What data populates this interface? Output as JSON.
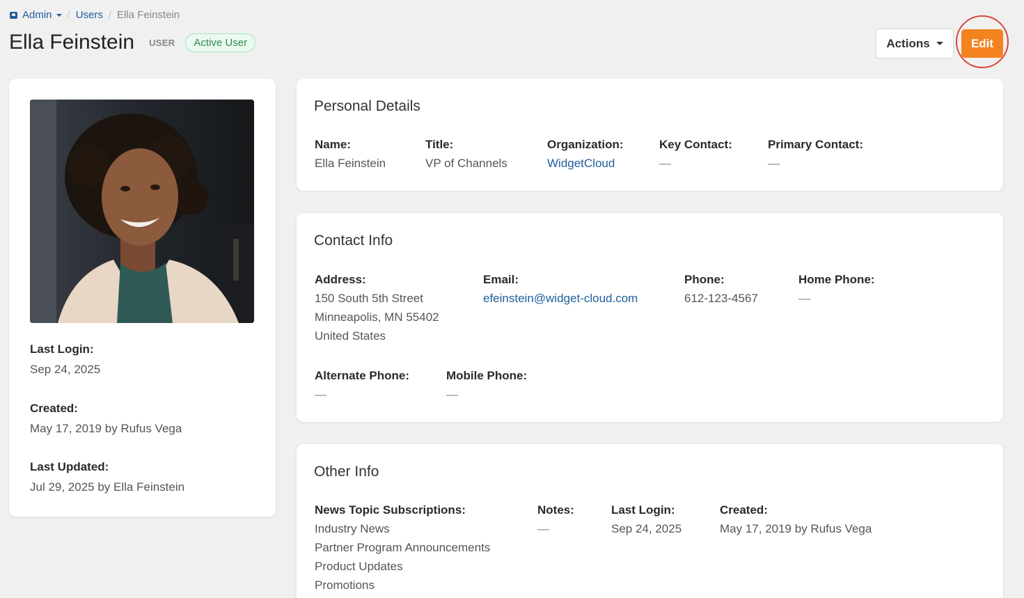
{
  "breadcrumb": {
    "admin": "Admin",
    "separator": "/",
    "users": "Users",
    "current": "Ella Feinstein"
  },
  "header": {
    "title": "Ella Feinstein",
    "role": "USER",
    "status": "Active User",
    "actions_label": "Actions",
    "edit_label": "Edit"
  },
  "profile": {
    "last_login_label": "Last Login:",
    "last_login": "Sep 24, 2025",
    "created_label": "Created:",
    "created": "May 17, 2019 by Rufus Vega",
    "last_updated_label": "Last Updated:",
    "last_updated": "Jul 29, 2025 by Ella Feinstein"
  },
  "personal": {
    "title": "Personal Details",
    "name_label": "Name:",
    "name": "Ella Feinstein",
    "title_label": "Title:",
    "job_title": "VP of Channels",
    "org_label": "Organization:",
    "org": "WidgetCloud",
    "key_label": "Key Contact:",
    "key": "—",
    "primary_label": "Primary Contact:",
    "primary": "—"
  },
  "contact": {
    "title": "Contact Info",
    "address_label": "Address:",
    "address_line1": "150 South 5th Street",
    "address_line2": "Minneapolis, MN 55402",
    "address_line3": "United States",
    "email_label": "Email:",
    "email": "efeinstein@widget-cloud.com",
    "phone_label": "Phone:",
    "phone": "612-123-4567",
    "home_label": "Home Phone:",
    "home": "—",
    "alt_label": "Alternate Phone:",
    "alt": "—",
    "mobile_label": "Mobile Phone:",
    "mobile": "—"
  },
  "other": {
    "title": "Other Info",
    "subs_label": "News Topic Subscriptions:",
    "subs": [
      "Industry News",
      "Partner Program Announcements",
      "Product Updates",
      "Promotions"
    ],
    "notes_label": "Notes:",
    "notes": "—",
    "last_login_label": "Last Login:",
    "last_login": "Sep 24, 2025",
    "created_label": "Created:",
    "created": "May 17, 2019 by Rufus Vega"
  },
  "colors": {
    "accent": "#f4831f",
    "link": "#1f5e9c",
    "status_green": "#2e8a4e",
    "highlight_ring": "#d9483b"
  }
}
